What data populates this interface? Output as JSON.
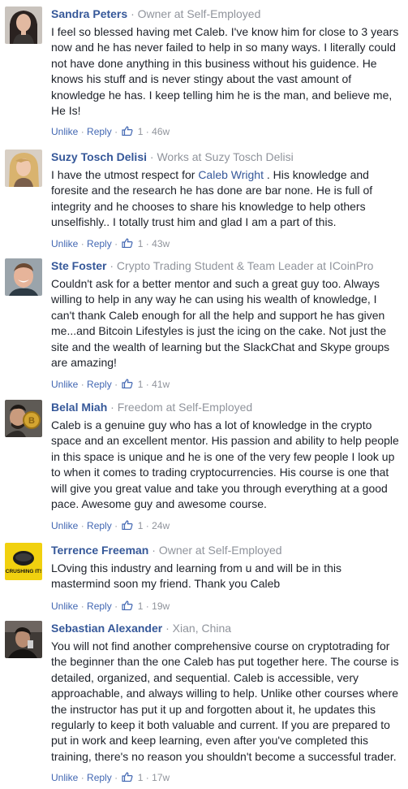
{
  "like_icon_name": "thumbs-up-icon",
  "action_labels": {
    "unlike": "Unlike",
    "reply": "Reply",
    "dot": "·"
  },
  "comments": [
    {
      "name": "Sandra Peters",
      "role": "Owner at Self-Employed",
      "text_before": "I feel so blessed having met Caleb. I've know him for close to 3 years now and he has never failed to help in so many ways. I literally could not have done anything in this business without his guidence. He knows his stuff and is never stingy about the vast amount of knowledge he has. I keep telling him he is the man, and believe me, He Is!",
      "link": "",
      "text_after": "",
      "likes": "1",
      "time": "46w",
      "avatar": "woman-dark-hair-avatar"
    },
    {
      "name": "Suzy Tosch Delisi",
      "role": "Works at Suzy Tosch Delisi",
      "text_before": "I have the utmost respect for ",
      "link": "Caleb Wright",
      "text_after": " . His knowledge and foresite and the research he has done are bar none. He is full of integrity and he chooses to share his knowledge to help others unselfishly.. I totally trust him and glad I am a part of this.",
      "likes": "1",
      "time": "43w",
      "avatar": "woman-blonde-avatar"
    },
    {
      "name": "Ste Foster",
      "role": "Crypto Trading Student & Team Leader at ICoinPro",
      "text_before": "Couldn't ask for a better mentor and such a great guy too. Always willing to help in any way he can using his wealth of knowledge, I can't thank Caleb enough for all the help and support he has given me...and Bitcoin Lifestyles is just the icing on the cake. Not just the site and the wealth of learning but the SlackChat and Skype groups are amazing!",
      "link": "",
      "text_after": "",
      "likes": "1",
      "time": "41w",
      "avatar": "man-smiling-avatar"
    },
    {
      "name": "Belal Miah",
      "role": "Freedom at Self-Employed",
      "text_before": "Caleb is a genuine guy who has a lot of knowledge in the crypto space and an excellent mentor. His passion and ability to help people in this space is unique and he is one of the very few people I look up to when it comes to trading cryptocurrencies. His course is one that will give you great value and take you through everything at a good pace. Awesome guy and awesome course.",
      "link": "",
      "text_after": "",
      "likes": "1",
      "time": "24w",
      "avatar": "man-gold-coin-avatar"
    },
    {
      "name": "Terrence Freeman",
      "role": "Owner at Self-Employed",
      "text_before": "LOving this industry and learning from u and will be in this mastermind soon my friend. Thank you Caleb",
      "link": "",
      "text_after": "",
      "likes": "1",
      "time": "19w",
      "avatar": "crushing-it-avatar",
      "avatar_text": "CRUSHING IT!"
    },
    {
      "name": "Sebastian Alexander",
      "role": "Xian, China",
      "text_before": "You will not find another comprehensive course on cryptotrading for the beginner than the one Caleb has put together here. The course is detailed, organized, and sequential. Caleb is accessible, very approachable, and always willing to help. Unlike other courses where the instructor has put it up and forgotten about it, he updates this regularly to keep it both valuable and current. If you are prepared to put in work and keep learning, even after you've completed this training, there's no reason you shouldn't become a successful trader.",
      "link": "",
      "text_after": "",
      "likes": "1",
      "time": "17w",
      "avatar": "man-dark-photo-avatar"
    }
  ]
}
